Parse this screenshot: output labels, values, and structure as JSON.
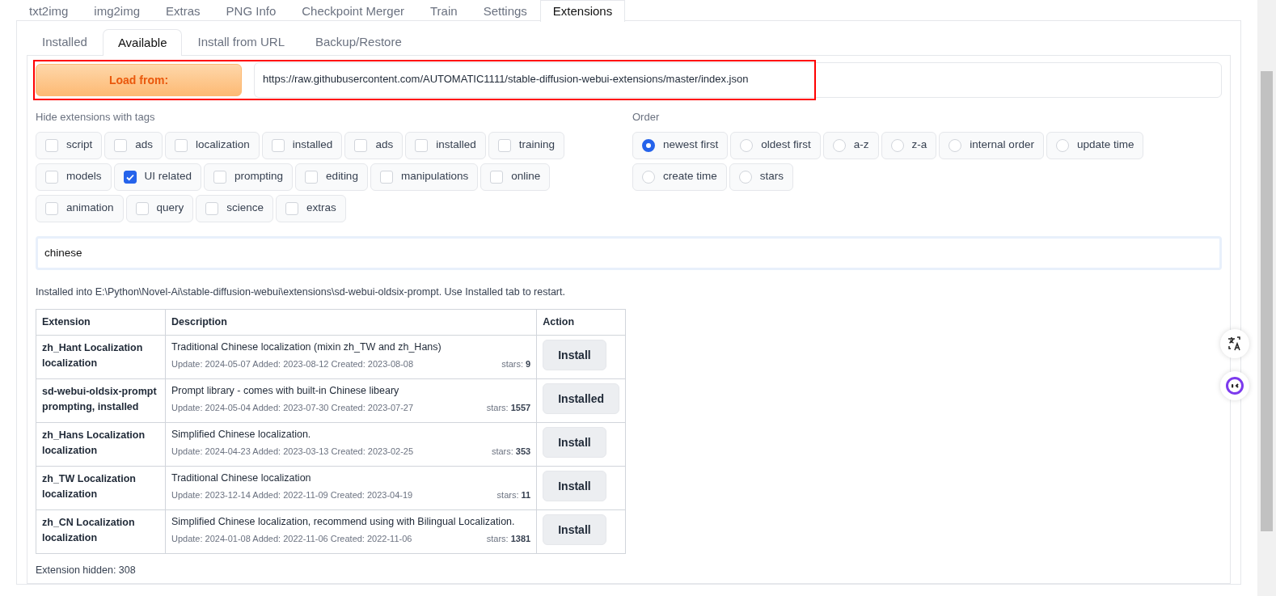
{
  "top_tabs": [
    {
      "label": "txt2img",
      "selected": false
    },
    {
      "label": "img2img",
      "selected": false
    },
    {
      "label": "Extras",
      "selected": false
    },
    {
      "label": "PNG Info",
      "selected": false
    },
    {
      "label": "Checkpoint Merger",
      "selected": false
    },
    {
      "label": "Train",
      "selected": false
    },
    {
      "label": "Settings",
      "selected": false
    },
    {
      "label": "Extensions",
      "selected": true
    }
  ],
  "sub_tabs": [
    {
      "label": "Installed",
      "selected": false
    },
    {
      "label": "Available",
      "selected": true
    },
    {
      "label": "Install from URL",
      "selected": false
    },
    {
      "label": "Backup/Restore",
      "selected": false
    }
  ],
  "load_from": {
    "button": "Load from:",
    "url": "https://raw.githubusercontent.com/AUTOMATIC1111/stable-diffusion-webui-extensions/master/index.json",
    "highlighted": true
  },
  "hide_tags": {
    "label": "Hide extensions with tags",
    "tags": [
      {
        "label": "script",
        "checked": false
      },
      {
        "label": "ads",
        "checked": false
      },
      {
        "label": "localization",
        "checked": false
      },
      {
        "label": "installed",
        "checked": false
      },
      {
        "label": "ads",
        "checked": false
      },
      {
        "label": "installed",
        "checked": false
      },
      {
        "label": "training",
        "checked": false
      },
      {
        "label": "models",
        "checked": false
      },
      {
        "label": "UI related",
        "checked": true
      },
      {
        "label": "prompting",
        "checked": false
      },
      {
        "label": "editing",
        "checked": false
      },
      {
        "label": "manipulations",
        "checked": false
      },
      {
        "label": "online",
        "checked": false
      },
      {
        "label": "animation",
        "checked": false
      },
      {
        "label": "query",
        "checked": false
      },
      {
        "label": "science",
        "checked": false
      },
      {
        "label": "extras",
        "checked": false
      }
    ]
  },
  "order": {
    "label": "Order",
    "options": [
      {
        "label": "newest first",
        "selected": true
      },
      {
        "label": "oldest first",
        "selected": false
      },
      {
        "label": "a-z",
        "selected": false
      },
      {
        "label": "z-a",
        "selected": false
      },
      {
        "label": "internal order",
        "selected": false
      },
      {
        "label": "update time",
        "selected": false
      },
      {
        "label": "create time",
        "selected": false
      },
      {
        "label": "stars",
        "selected": false
      }
    ]
  },
  "search": {
    "value": "chinese"
  },
  "install_message": "Installed into E:\\Python\\Novel-Ai\\stable-diffusion-webui\\extensions\\sd-webui-oldsix-prompt. Use Installed tab to restart.",
  "table": {
    "columns": [
      "Extension",
      "Description",
      "Action"
    ],
    "rows": [
      {
        "name": "zh_Hant Localization",
        "tags": "localization",
        "description": "Traditional Chinese localization (mixin zh_TW and zh_Hans)",
        "dates": "Update: 2024-05-07 Added: 2023-08-12 Created: 2023-08-08",
        "stars": "stars: **9**",
        "action": "Install"
      },
      {
        "name": "sd-webui-oldsix-prompt",
        "tags": "prompting, installed",
        "description": "Prompt library - comes with built-in Chinese libeary",
        "dates": "Update: 2024-05-04 Added: 2023-07-30 Created: 2023-07-27",
        "stars": "stars: **1557**",
        "action": "Installed"
      },
      {
        "name": "zh_Hans Localization",
        "tags": "localization",
        "description": "Simplified Chinese localization.",
        "dates": "Update: 2024-04-23 Added: 2023-03-13 Created: 2023-02-25",
        "stars": "stars: **353**",
        "action": "Install"
      },
      {
        "name": "zh_TW Localization",
        "tags": "localization",
        "description": "Traditional Chinese localization",
        "dates": "Update: 2023-12-14 Added: 2022-11-09 Created: 2023-04-19",
        "stars": "stars: **11**",
        "action": "Install"
      },
      {
        "name": "zh_CN Localization",
        "tags": "localization",
        "description": "Simplified Chinese localization, recommend using with Bilingual Localization.",
        "dates": "Update: 2024-01-08 Added: 2022-11-06 Created: 2022-11-06",
        "stars": "stars: **1381**",
        "action": "Install"
      }
    ]
  },
  "extension_hidden": "Extension hidden: 308"
}
